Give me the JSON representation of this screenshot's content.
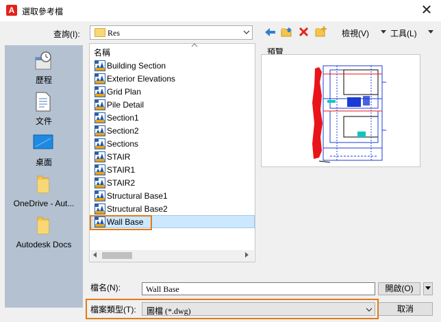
{
  "window": {
    "title": "選取參考檔",
    "app_icon_letter": "A",
    "close_glyph": "✕"
  },
  "lookin": {
    "label": "查詢(I):",
    "value": "Res"
  },
  "toolbar": {
    "views_label": "檢視(V)",
    "tools_label": "工具(L)"
  },
  "places": [
    {
      "label": "歷程",
      "icon": "clock-icon"
    },
    {
      "label": "文件",
      "icon": "document-icon"
    },
    {
      "label": "桌面",
      "icon": "desktop-icon"
    },
    {
      "label": "OneDrive - Aut...",
      "icon": "folder-icon"
    },
    {
      "label": "Autodesk Docs",
      "icon": "folder-icon"
    }
  ],
  "filelist": {
    "column_header": "名稱",
    "files": [
      "Building Section",
      "Exterior Elevations",
      "Grid Plan",
      "Pile Detail",
      "Section1",
      "Section2",
      "Sections",
      "STAIR",
      "STAIR1",
      "STAIR2",
      "Structural Base1",
      "Structural Base2",
      "Wall Base"
    ],
    "selected": "Wall Base"
  },
  "preview": {
    "label": "預覽"
  },
  "filename": {
    "label": "檔名(N):",
    "value": "Wall Base"
  },
  "filetype": {
    "label": "檔案類型(T):",
    "value": "圖檔 (*.dwg)"
  },
  "buttons": {
    "open": "開啟(O)",
    "cancel": "取消"
  },
  "colors": {
    "accent_highlight": "#e07b18",
    "places_bar": "#b4c1d0",
    "selection": "#cce8ff"
  }
}
